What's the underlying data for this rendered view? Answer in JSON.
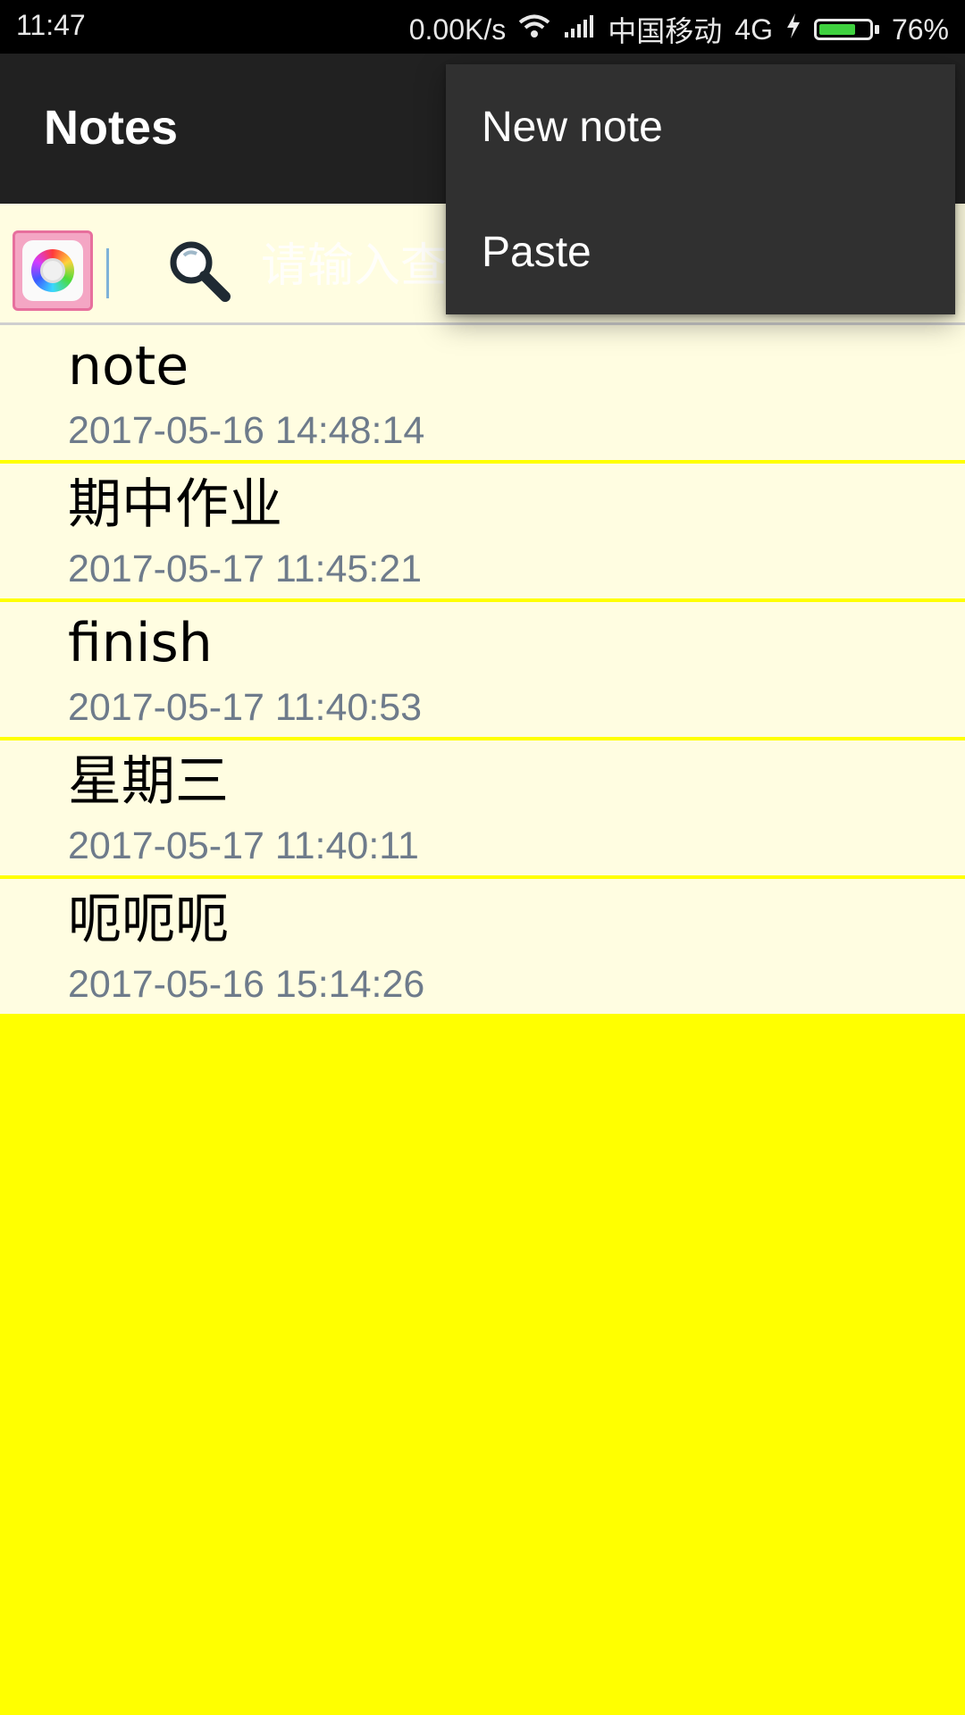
{
  "status_bar": {
    "time": "11:47",
    "network_speed": "0.00K/s",
    "carrier": "中国移动",
    "network_type": "4G",
    "battery": "76%",
    "battery_level": 0.76,
    "icons": [
      "wifi-icon",
      "signal-icon",
      "charging-icon",
      "battery-icon"
    ]
  },
  "app_bar": {
    "title": "Notes"
  },
  "search": {
    "placeholder": "请输入查找内容",
    "value": ""
  },
  "notes": [
    {
      "title": "note",
      "date": "2017-05-16 14:48:14"
    },
    {
      "title": "期中作业",
      "date": "2017-05-17 11:45:21"
    },
    {
      "title": "finish",
      "date": "2017-05-17 11:40:53"
    },
    {
      "title": "星期三",
      "date": "2017-05-17 11:40:11"
    },
    {
      "title": "呃呃呃",
      "date": "2017-05-16 15:14:26"
    }
  ],
  "overflow_menu": {
    "items": [
      {
        "label": "New note"
      },
      {
        "label": "Paste"
      }
    ]
  },
  "colors": {
    "background": "#ffff00",
    "list_item_bg": "#fffde1",
    "app_bar": "#212121",
    "menu_bg": "#303030",
    "date_text": "#6e7b8b"
  }
}
